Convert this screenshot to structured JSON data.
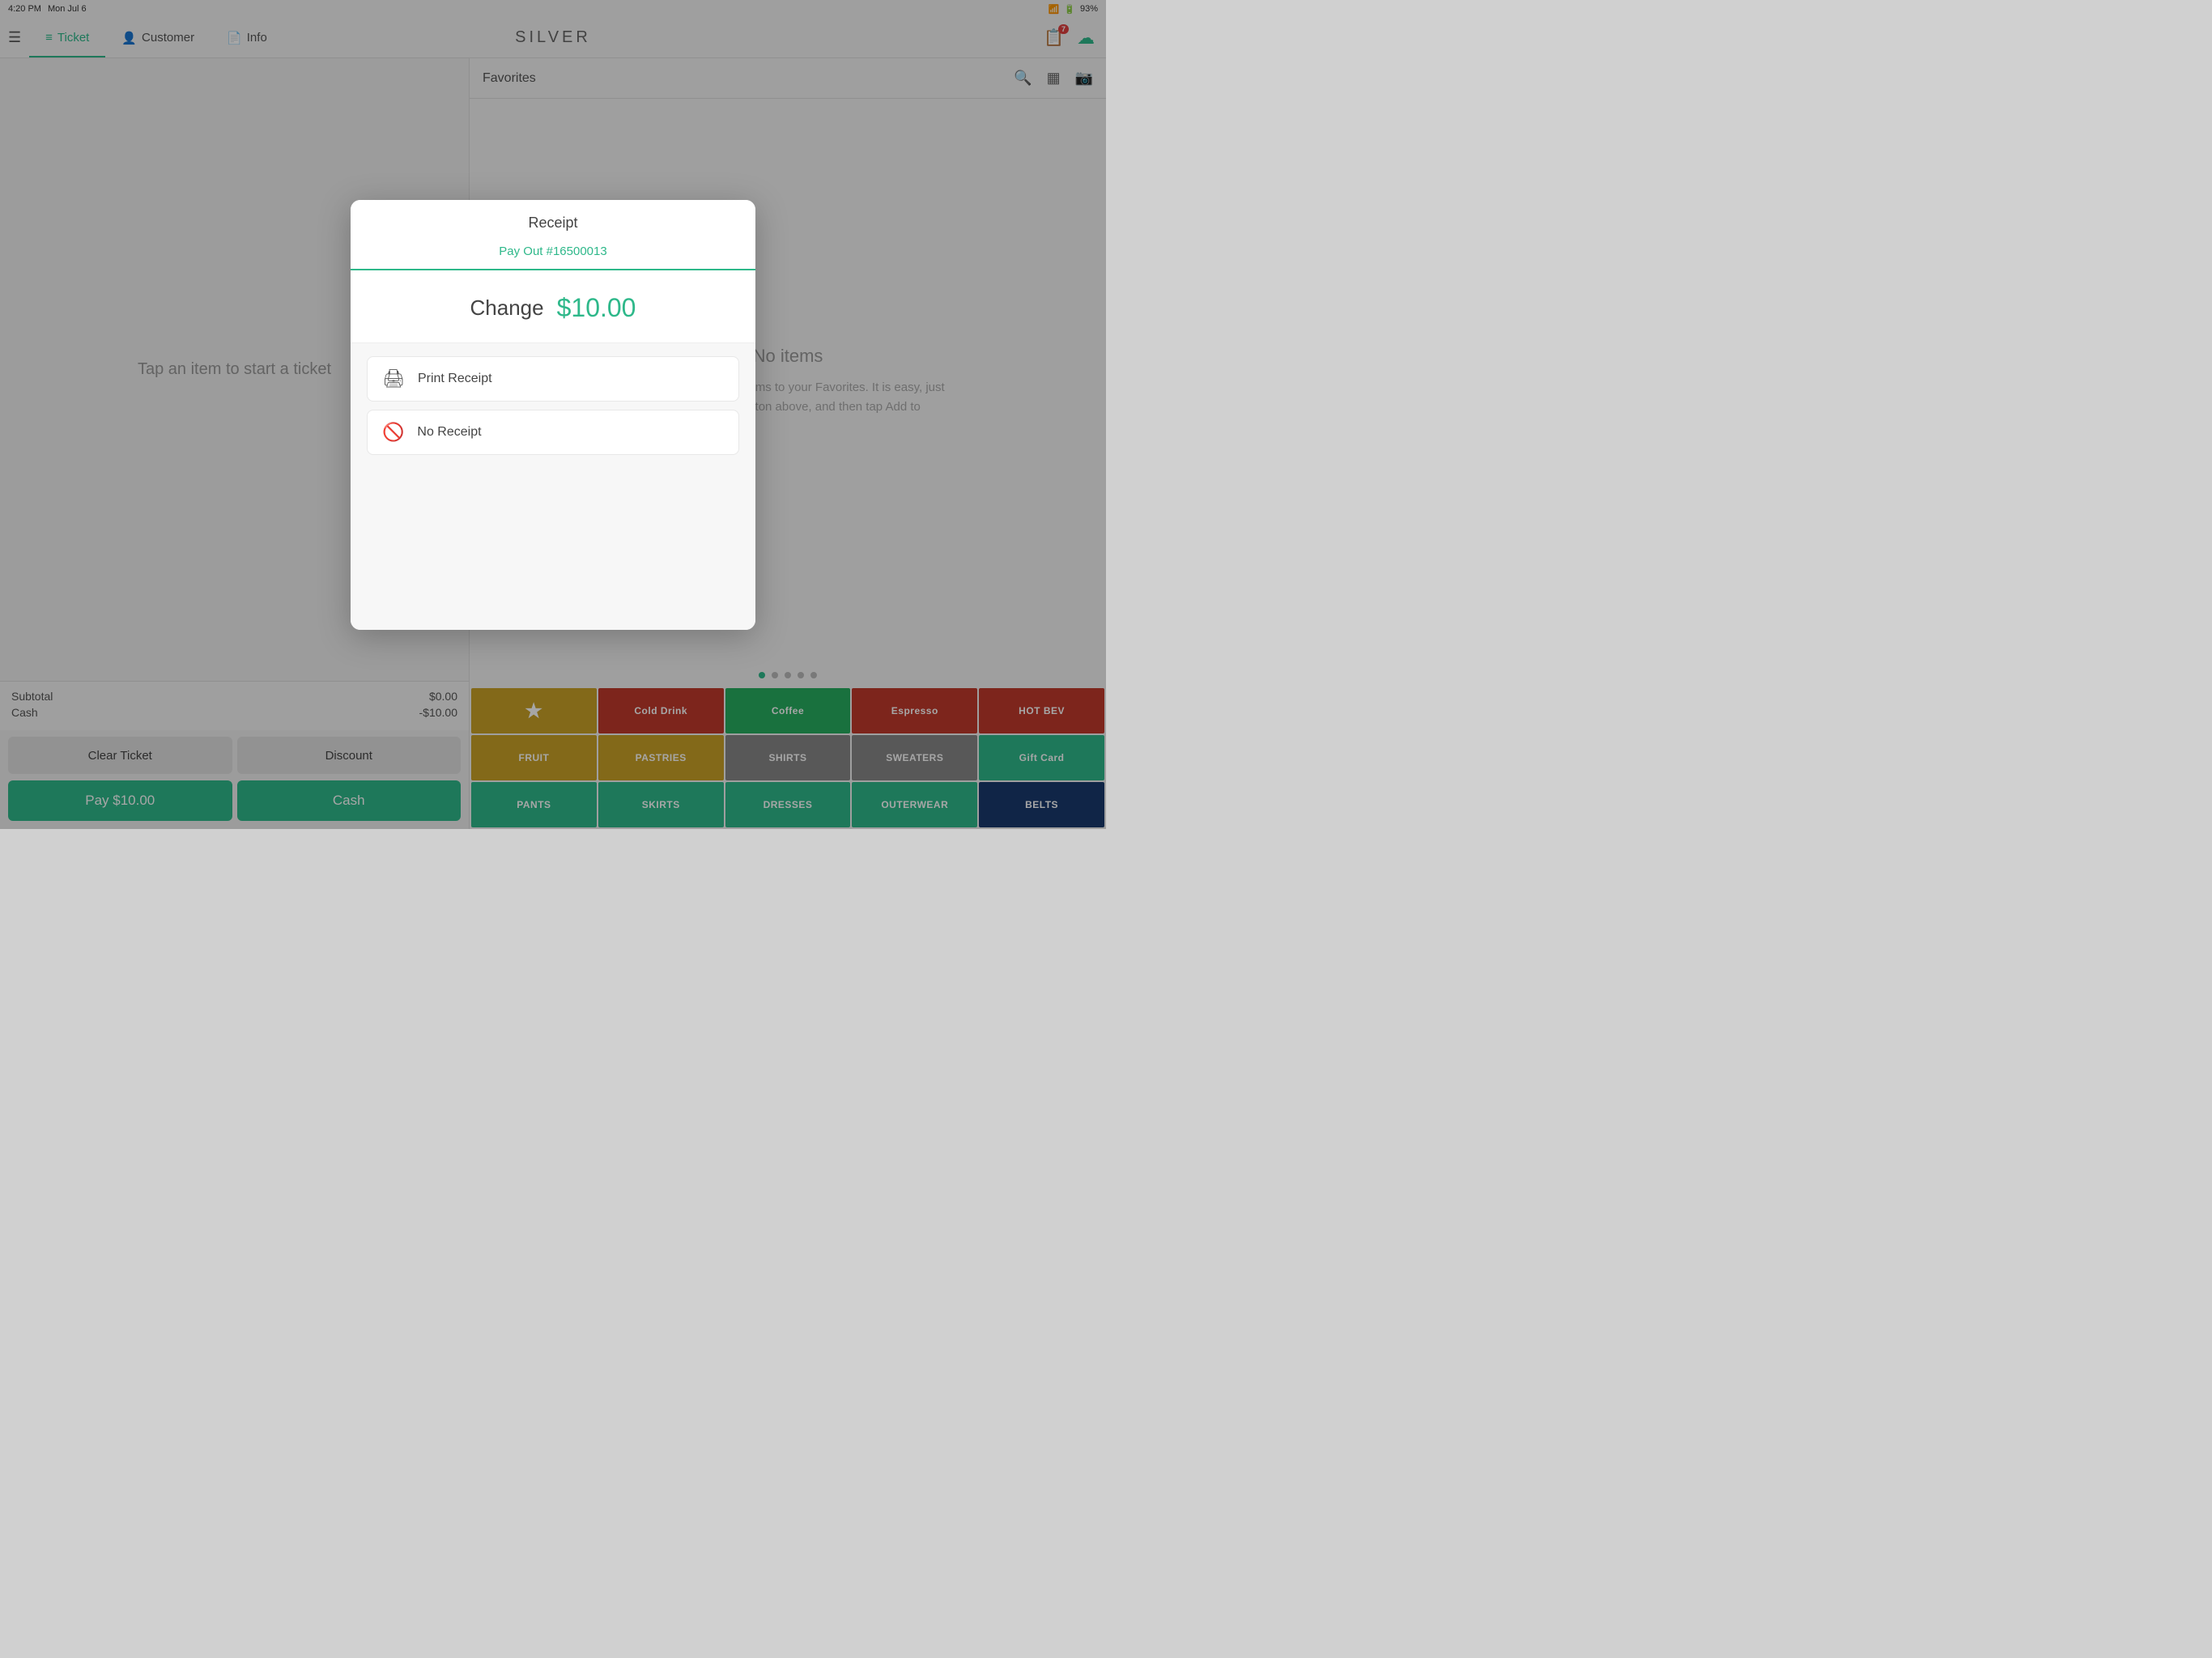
{
  "statusBar": {
    "time": "4:20 PM",
    "date": "Mon Jul 6",
    "battery": "93%"
  },
  "topNav": {
    "hamburger": "☰",
    "tabs": [
      {
        "id": "ticket",
        "label": "Ticket",
        "icon": "ticket-icon",
        "active": true
      },
      {
        "id": "customer",
        "label": "Customer",
        "icon": "person-icon",
        "active": false
      },
      {
        "id": "info",
        "label": "Info",
        "icon": "info-icon",
        "active": false
      }
    ],
    "logo": "SILVER",
    "badgeCount": "7"
  },
  "leftPanel": {
    "ticketHint": "Tap an item to start a ticket",
    "subtotalLabel": "Subtotal",
    "subtotalValue": "$0.00",
    "cashLabel": "Cash",
    "cashValue": "-$10.00",
    "clearTicketLabel": "Clear Ticket",
    "discountLabel": "Discount",
    "payLabel": "Pay $10.00",
    "cashButtonLabel": "Cash"
  },
  "rightPanel": {
    "favoritesLabel": "Favorites",
    "noItemsTitle": "No items",
    "noItemsDesc": "Add your most used items to your Favorites. It is easy, just use the search button above, and then tap Add to"
  },
  "categoryGrid": {
    "items": [
      {
        "id": "favorites",
        "label": "★",
        "colorClass": "cat-favorites"
      },
      {
        "id": "cold-drink",
        "label": "Cold Drink",
        "colorClass": "cat-cold-drink"
      },
      {
        "id": "coffee",
        "label": "Coffee",
        "colorClass": "cat-coffee"
      },
      {
        "id": "espresso",
        "label": "Espresso",
        "colorClass": "cat-espresso"
      },
      {
        "id": "hot-bev",
        "label": "HOT BEV",
        "colorClass": "cat-hot-bev"
      },
      {
        "id": "fruit",
        "label": "FRUIT",
        "colorClass": "cat-fruit"
      },
      {
        "id": "pastries",
        "label": "PASTRIES",
        "colorClass": "cat-pastries"
      },
      {
        "id": "shirts",
        "label": "SHIRTS",
        "colorClass": "cat-shirts"
      },
      {
        "id": "sweaters",
        "label": "SWEATERS",
        "colorClass": "cat-sweaters"
      },
      {
        "id": "gift-card",
        "label": "Gift Card",
        "colorClass": "cat-gift-card"
      },
      {
        "id": "pants",
        "label": "PANTS",
        "colorClass": "cat-pants"
      },
      {
        "id": "skirts",
        "label": "SKIRTS",
        "colorClass": "cat-skirts"
      },
      {
        "id": "dresses",
        "label": "DRESSES",
        "colorClass": "cat-dresses"
      },
      {
        "id": "outerwear",
        "label": "OUTERWEAR",
        "colorClass": "cat-outerwear"
      },
      {
        "id": "belts",
        "label": "BELTS",
        "colorClass": "cat-belts"
      }
    ]
  },
  "modal": {
    "title": "Receipt",
    "payoutNumber": "Pay Out #16500013",
    "changeLabel": "Change",
    "changeAmount": "$10.00",
    "printReceiptLabel": "Print Receipt",
    "noReceiptLabel": "No Receipt"
  }
}
